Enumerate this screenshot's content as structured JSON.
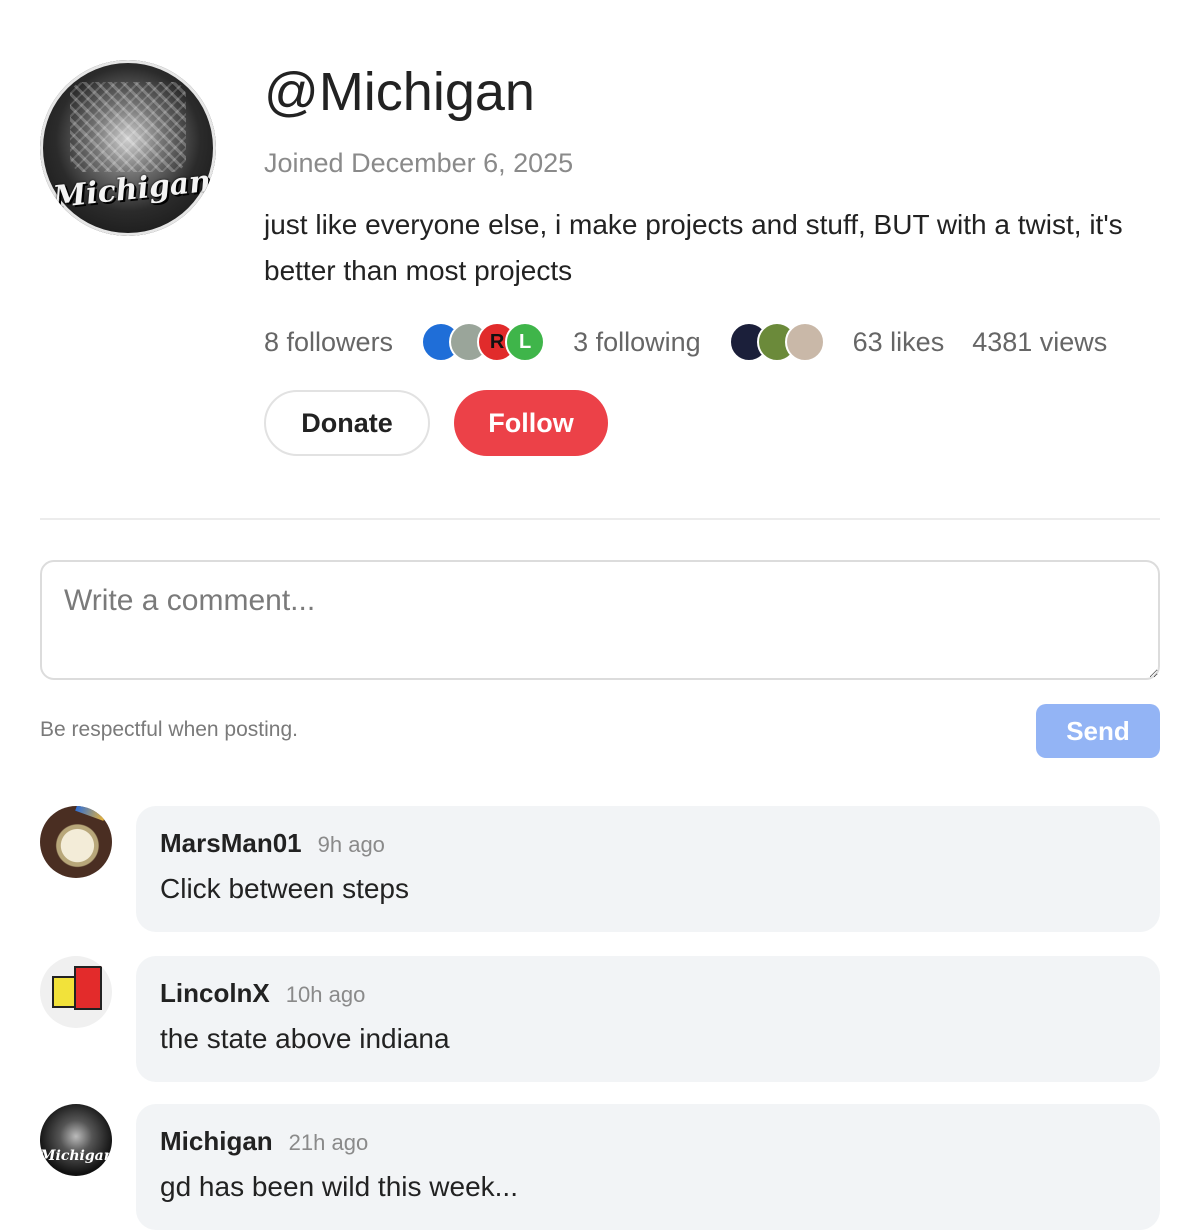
{
  "profile": {
    "handle": "@Michigan",
    "joined": "Joined December 6, 2025",
    "bio": "just like everyone else, i make projects and stuff, BUT with a twist, it's better than most projects",
    "avatar_text": "Michigan",
    "followers": "8 followers",
    "following": "3 following",
    "likes": "63 likes",
    "views": "4381 views",
    "follower_avatars": [
      {
        "label": "",
        "color": "#1f6ed8"
      },
      {
        "label": "",
        "color": "#9aa59a"
      },
      {
        "label": "R",
        "color": "#e12b2b"
      },
      {
        "label": "L",
        "color": "#3fb54a"
      }
    ],
    "following_avatars": [
      {
        "label": "",
        "color": "#1b1f3a"
      },
      {
        "label": "",
        "color": "#6b8a3a"
      },
      {
        "label": "",
        "color": "#c9b8a8"
      }
    ]
  },
  "actions": {
    "donate_label": "Donate",
    "follow_label": "Follow"
  },
  "composer": {
    "placeholder": "Write a comment...",
    "hint": "Be respectful when posting.",
    "send_label": "Send"
  },
  "comments": [
    {
      "user": "MarsMan01",
      "time": "9h ago",
      "text": "Click between steps"
    },
    {
      "user": "LincolnX",
      "time": "10h ago",
      "text": "the state above indiana"
    },
    {
      "user": "Michigan",
      "time": "21h ago",
      "text": "gd has been wild this week..."
    }
  ],
  "colors": {
    "follow": "#ec4148",
    "send": "#93b4f5",
    "bubble": "#f2f4f6"
  }
}
